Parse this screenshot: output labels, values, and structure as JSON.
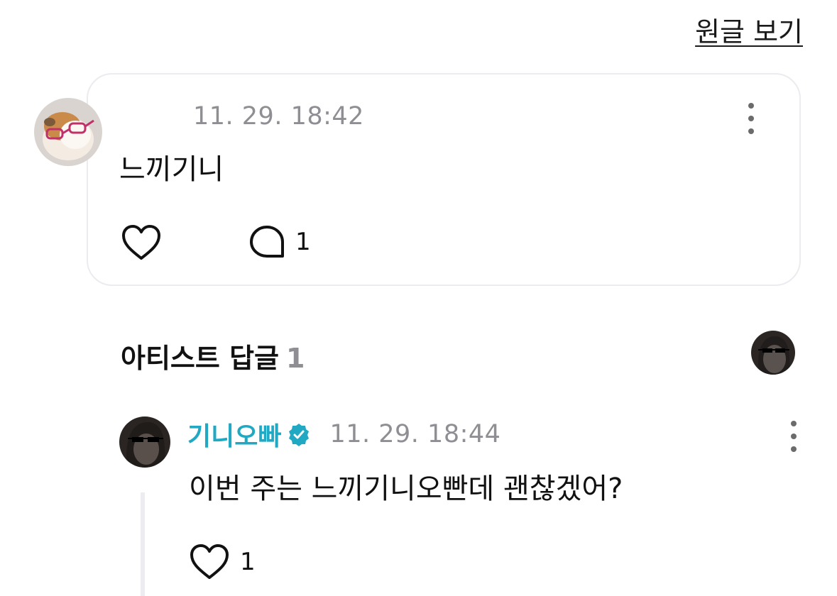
{
  "header": {
    "view_original_label": "원글 보기"
  },
  "comment": {
    "timestamp": "11. 29. 18:42",
    "text": "느끼기니",
    "reply_count": "1"
  },
  "artist_replies": {
    "title": "아티스트 답글",
    "count": "1"
  },
  "reply": {
    "author": "기니오빠",
    "timestamp": "11. 29. 18:44",
    "text": "이번 주는 느끼기니오빤데 괜찮겠어?",
    "like_count": "1"
  },
  "colors": {
    "accent": "#21a9c4",
    "muted": "#8e8e93",
    "border": "#ebebf0"
  }
}
